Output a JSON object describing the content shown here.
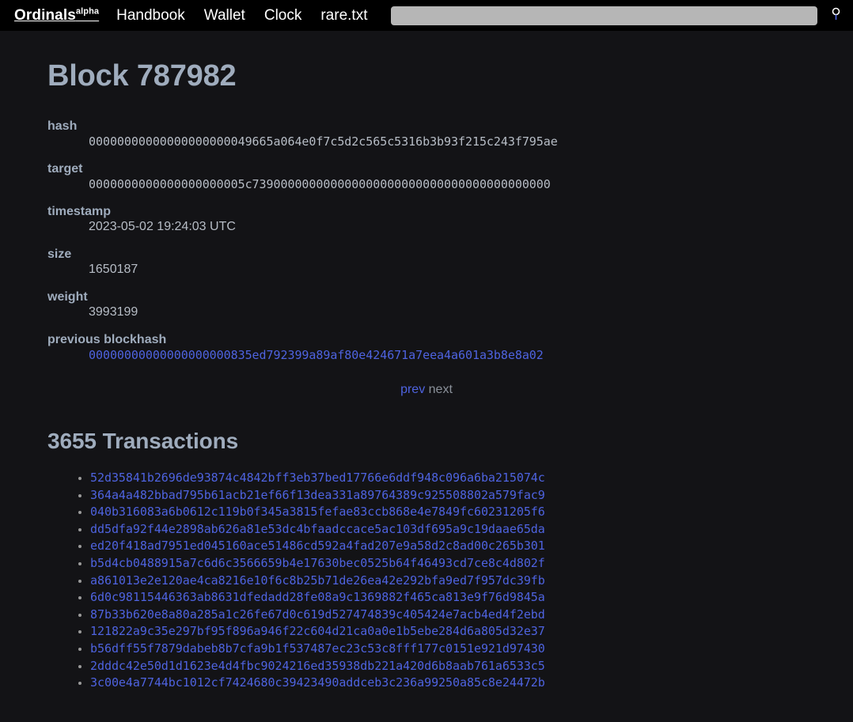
{
  "header": {
    "brand": "Ordinals",
    "brand_sup": "alpha",
    "nav_items": [
      {
        "label": "Handbook",
        "name": "nav-link-handbook"
      },
      {
        "label": "Wallet",
        "name": "nav-link-wallet"
      },
      {
        "label": "Clock",
        "name": "nav-link-clock"
      },
      {
        "label": "rare.txt",
        "name": "nav-link-rare-txt"
      }
    ],
    "search": {
      "value": "",
      "placeholder": "",
      "submit_icon": "search-icon"
    }
  },
  "page": {
    "title": "Block 787982",
    "details": [
      {
        "label": "hash",
        "value": "00000000000000000000049665a064e0f7c5d2c565c5316b3b93f215c243f795ae",
        "mono": true,
        "link": false
      },
      {
        "label": "target",
        "value": "0000000000000000000005c739000000000000000000000000000000000000000",
        "mono": true,
        "link": false
      },
      {
        "label": "timestamp",
        "value": "2023-05-02 19:24:03 UTC",
        "mono": false,
        "link": false
      },
      {
        "label": "size",
        "value": "1650187",
        "mono": false,
        "link": false
      },
      {
        "label": "weight",
        "value": "3993199",
        "mono": false,
        "link": false
      },
      {
        "label": "previous blockhash",
        "value": "00000000000000000000835ed792399a89af80e424671a7eea4a601a3b8e8a02",
        "mono": true,
        "link": true
      }
    ],
    "pager": {
      "prev": "prev",
      "next": "next"
    },
    "transactions_heading": "3655 Transactions",
    "transactions": [
      "52d35841b2696de93874c4842bff3eb37bed17766e6ddf948c096a6ba215074c",
      "364a4a482bbad795b61acb21ef66f13dea331a89764389c925508802a579fac9",
      "040b316083a6b0612c119b0f345a3815fefae83ccb868e4e7849fc60231205f6",
      "dd5dfa92f44e2898ab626a81e53dc4bfaadccace5ac103df695a9c19daae65da",
      "ed20f418ad7951ed045160ace51486cd592a4fad207e9a58d2c8ad00c265b301",
      "b5d4cb0488915a7c6d6c3566659b4e17630bec0525b64f46493cd7ce8c4d802f",
      "a861013e2e120ae4ca8216e10f6c8b25b71de26ea42e292bfa9ed7f957dc39fb",
      "6d0c98115446363ab8631dfedadd28fe08a9c1369882f465ca813e9f76d9845a",
      "87b33b620e8a80a285a1c26fe67d0c619d527474839c405424e7acb4ed4f2ebd",
      "121822a9c35e297bf95f896a946f22c604d21ca0a0e1b5ebe284d6a805d32e37",
      "b56dff55f7879dabeb8b7cfa9b1f537487ec23c53c8fff177c0151e921d97430",
      "2dddc42e50d1d1623e4d4fbc9024216ed35938db221a420d6b8aab761a6533c5",
      "3c00e4a7744bc1012cf7424680c39423490addceb3c236a99250a85c8e24472b"
    ]
  },
  "colors": {
    "nav_background": "#000000",
    "page_background": "#131316",
    "heading": "#9facbd",
    "text": "#b7bdc6",
    "link": "#4e63e0",
    "disabled": "#8a9099",
    "search_field": "#b6b6b6"
  }
}
